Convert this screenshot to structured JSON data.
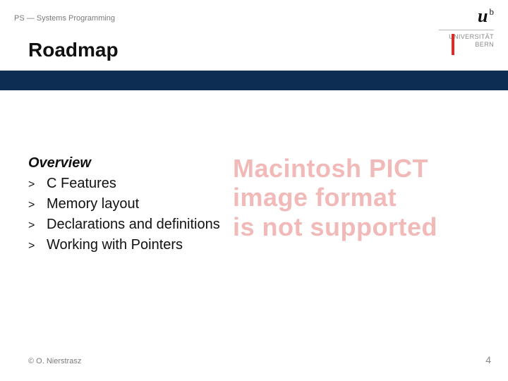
{
  "header": {
    "breadcrumb": "PS — Systems Programming",
    "title": "Roadmap"
  },
  "logo": {
    "mark": "u",
    "sup": "b",
    "line1": "UNIVERSITÄT",
    "line2": "BERN"
  },
  "overview": {
    "heading": "Overview",
    "items": [
      "C Features",
      "Memory layout",
      "Declarations and definitions",
      "Working with Pointers"
    ]
  },
  "watermark": {
    "line1": "Macintosh PICT",
    "line2": "image format",
    "line3": "is not supported"
  },
  "footer": {
    "left": "© O. Nierstrasz",
    "page": "4"
  }
}
